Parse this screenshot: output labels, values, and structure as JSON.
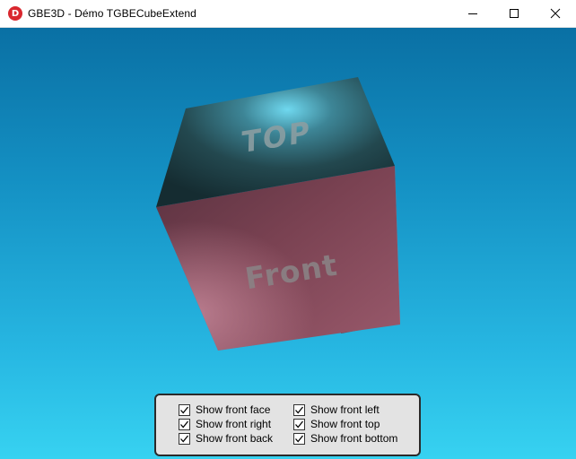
{
  "window": {
    "title": "GBE3D - Démo TGBECubeExtend",
    "icon_letter": "D",
    "icon": "app-logo-icon",
    "controls": [
      "minimize-icon",
      "maximize-icon",
      "close-icon"
    ]
  },
  "scene": {
    "cube_top_label": "TOP",
    "cube_front_label": "Front"
  },
  "options": [
    {
      "label": "Show front face",
      "checked": true
    },
    {
      "label": "Show front right",
      "checked": true
    },
    {
      "label": "Show front back",
      "checked": true
    },
    {
      "label": "Show front left",
      "checked": true
    },
    {
      "label": "Show front top",
      "checked": true
    },
    {
      "label": "Show front bottom",
      "checked": true
    }
  ],
  "colors": {
    "background_top": "#0a70a4",
    "background_bottom": "#37d2f1",
    "cube_top": "#1f4a52",
    "cube_front": "#8a4e5d",
    "cube_right": "#96505f",
    "icon_red": "#d9272e"
  }
}
